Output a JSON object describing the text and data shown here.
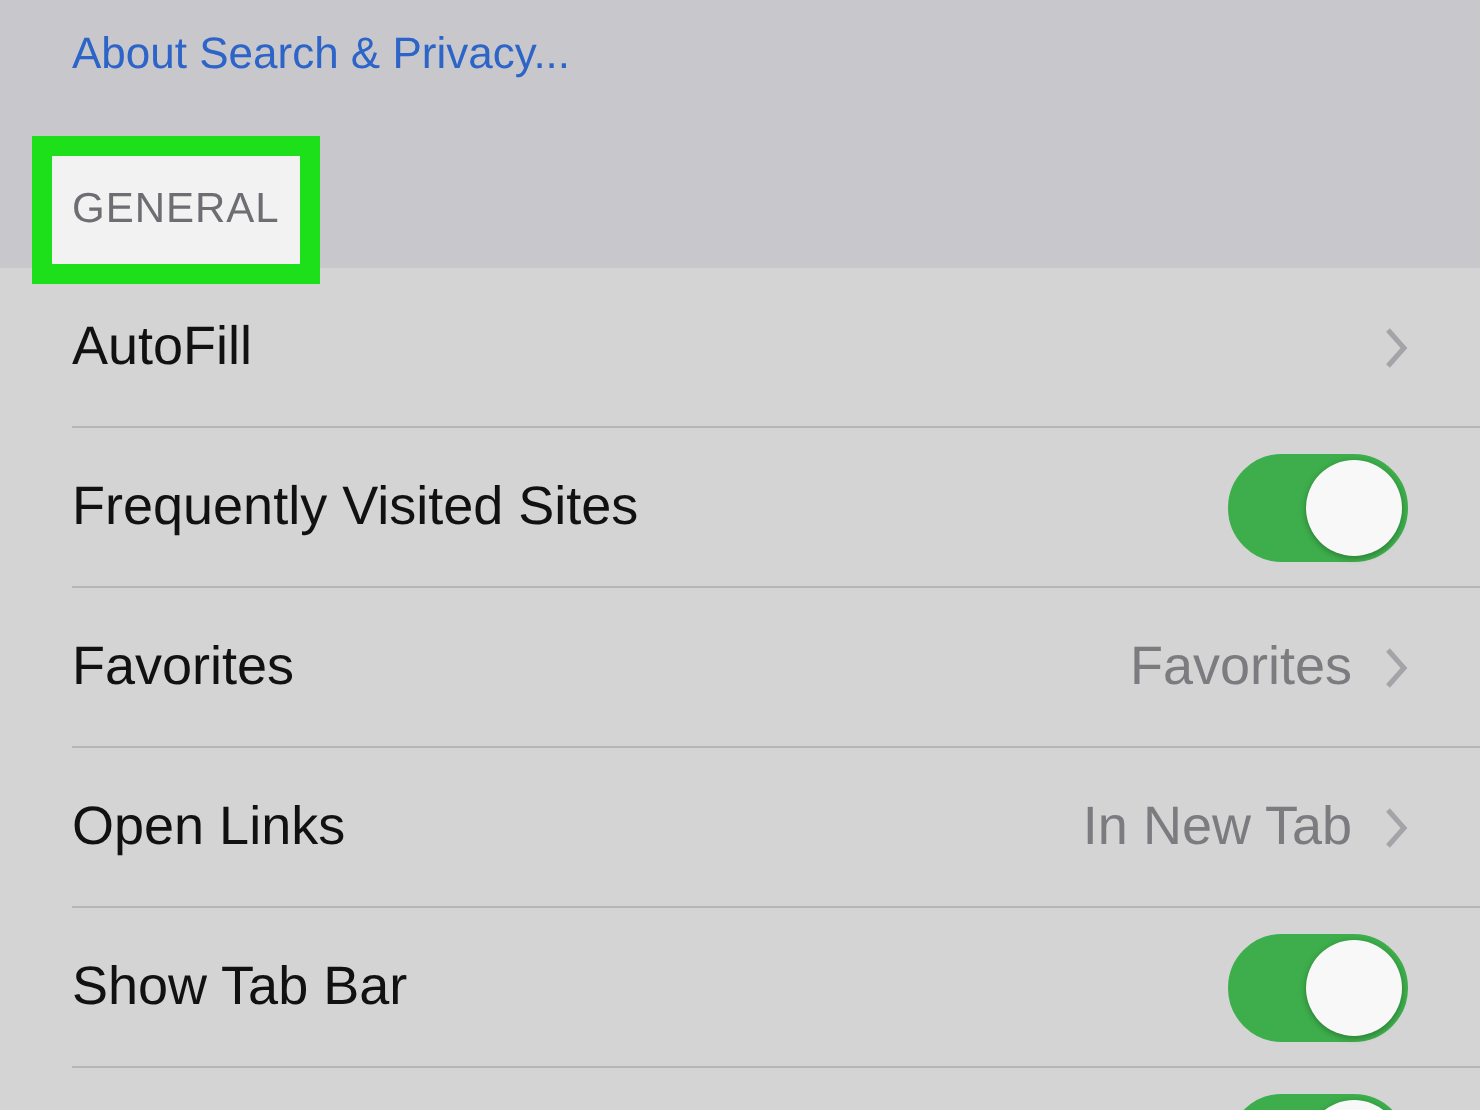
{
  "link": "About Search & Privacy...",
  "section": {
    "title": "GENERAL",
    "highlighted": true
  },
  "rows": [
    {
      "kind": "link",
      "label": "AutoFill"
    },
    {
      "kind": "toggle",
      "label": "Frequently Visited Sites",
      "on": true
    },
    {
      "kind": "link",
      "label": "Favorites",
      "value": "Favorites"
    },
    {
      "kind": "link",
      "label": "Open Links",
      "value": "In New Tab"
    },
    {
      "kind": "toggle",
      "label": "Show Tab Bar",
      "on": true
    },
    {
      "kind": "toggle",
      "on": true
    }
  ]
}
